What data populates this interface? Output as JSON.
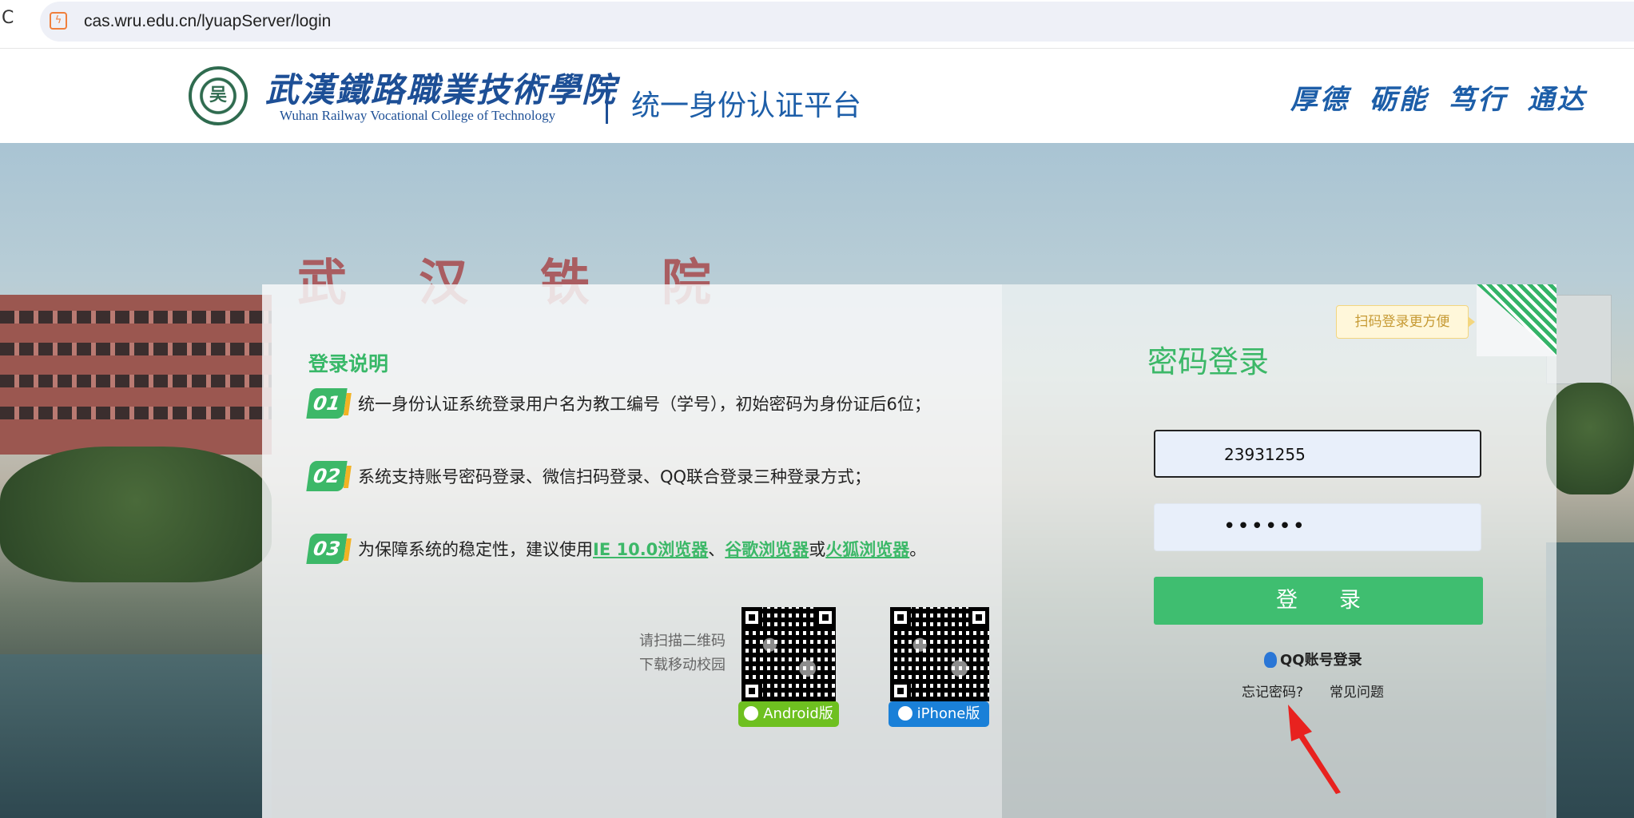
{
  "browser": {
    "url": "cas.wru.edu.cn/lyuapServer/login",
    "reload_glyph": "C",
    "site_icon_glyph": "ϟ"
  },
  "header": {
    "college_name_cn": "武漢鐵路職業技術學院",
    "college_name_en": "Wuhan Railway Vocational College of Technology",
    "emblem_mark": "吴",
    "platform_title": "统一身份认证平台",
    "motto": "厚德 砺能 笃行 通达"
  },
  "background": {
    "sign_letters": "武汉铁院"
  },
  "info": {
    "title": "登录说明",
    "steps": [
      {
        "num": "01",
        "text": "统一身份认证系统登录用户名为教工编号（学号），初始密码为身份证后6位；"
      },
      {
        "num": "02",
        "text": "系统支持账号密码登录、微信扫码登录、QQ联合登录三种登录方式；"
      },
      {
        "num": "03",
        "text_before": "为保障系统的稳定性，建议使用",
        "link_ie": "IE 10.0浏览器",
        "sep1": "、",
        "link_chrome": "谷歌浏览器",
        "sep2": "或",
        "link_firefox": "火狐浏览器",
        "end": "。"
      }
    ],
    "qr_caption_line1": "请扫描二维码",
    "qr_caption_line2": "下载移动校园",
    "android_label": "Android版",
    "iphone_label": "iPhone版"
  },
  "login": {
    "heading": "密码登录",
    "qr_tip": "扫码登录更方便",
    "username_value": "23931255",
    "password_value": "••••••",
    "login_button": "登录",
    "qq_login": "QQ账号登录",
    "forgot_password": "忘记密码?",
    "faq": "常见问题"
  },
  "colors": {
    "accent_green": "#3cb868",
    "brand_blue": "#1d5ea8",
    "annotation_red": "#e8221f",
    "android_green": "#6ec020",
    "iphone_blue": "#1a80d8"
  }
}
